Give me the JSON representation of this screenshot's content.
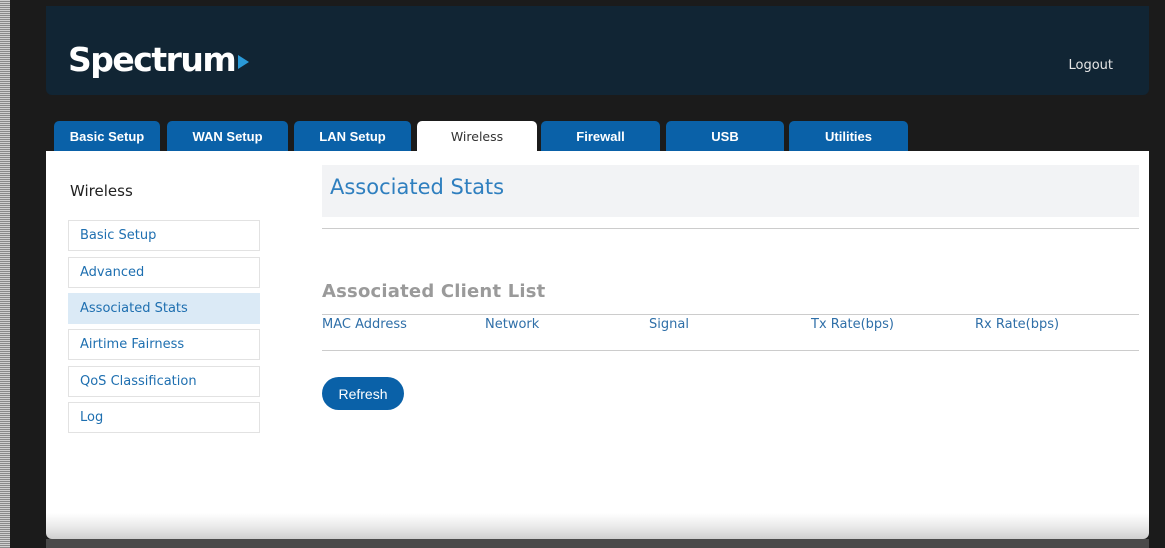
{
  "header": {
    "logo": "Spectrum",
    "logout_label": "Logout"
  },
  "tabs": [
    {
      "label": "Basic Setup"
    },
    {
      "label": "WAN Setup"
    },
    {
      "label": "LAN Setup"
    },
    {
      "label": "Wireless",
      "active": true
    },
    {
      "label": "Firewall"
    },
    {
      "label": "USB"
    },
    {
      "label": "Utilities"
    }
  ],
  "sidebar": {
    "title": "Wireless",
    "items": [
      {
        "label": "Basic Setup"
      },
      {
        "label": "Advanced"
      },
      {
        "label": "Associated Stats",
        "active": true
      },
      {
        "label": "Airtime Fairness"
      },
      {
        "label": "QoS Classification"
      },
      {
        "label": "Log"
      }
    ]
  },
  "main": {
    "title": "Associated Stats",
    "section_title": "Associated Client List",
    "columns": [
      "MAC Address",
      "Network",
      "Signal",
      "Tx Rate(bps)",
      "Rx Rate(bps)"
    ],
    "rows": [],
    "refresh_label": "Refresh"
  },
  "colors": {
    "header_bg": "#112534",
    "tab_blue": "#0a61a8",
    "accent_blue": "#2f7fbf",
    "logo_arrow": "#2a9ad8"
  }
}
